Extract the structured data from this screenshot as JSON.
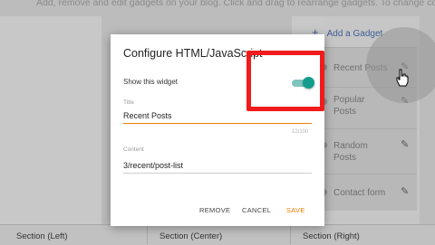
{
  "page": {
    "hint": "Add, remove and edit gadgets on your blog. Click and drag to rearrange gadgets. To change columns and widths",
    "add_gadget": "Add a Gadget"
  },
  "gadgets": [
    {
      "label": "Recent Posts"
    },
    {
      "label": "Popular Posts"
    },
    {
      "label": "Random Posts"
    },
    {
      "label": "Contact form"
    }
  ],
  "sections": [
    "Section (Left)",
    "Section (Center)",
    "Section (Right)"
  ],
  "dialog": {
    "title": "Configure HTML/JavaScript",
    "show_widget_label": "Show this widget",
    "show_widget_on": true,
    "title_field": {
      "label": "Title",
      "value": "Recent Posts",
      "counter": "12/100"
    },
    "content_field": {
      "label": "Content",
      "value": "3/recent/post-list"
    },
    "buttons": {
      "remove": "REMOVE",
      "cancel": "CANCEL",
      "save": "SAVE"
    }
  },
  "colors": {
    "accent": "#f57c00",
    "toggle": "#159c8c",
    "annotation": "#f11b1b"
  },
  "icons": [
    "plus-icon",
    "pencil-icon",
    "drag-handle-icon",
    "hand-cursor-icon"
  ]
}
